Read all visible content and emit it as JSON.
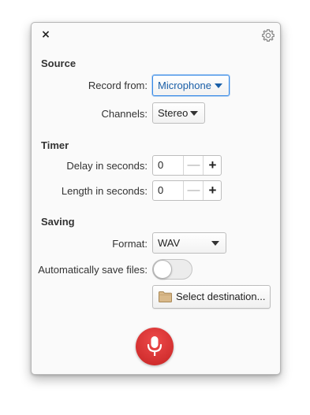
{
  "window": {
    "close_glyph": "×",
    "settings_icon": "gear-icon"
  },
  "source": {
    "title": "Source",
    "record_from_label": "Record from:",
    "record_from_value": "Microphone",
    "channels_label": "Channels:",
    "channels_value": "Stereo"
  },
  "timer": {
    "title": "Timer",
    "delay_label": "Delay in seconds:",
    "delay_value": "0",
    "length_label": "Length in seconds:",
    "length_value": "0",
    "minus_glyph": "—",
    "plus_glyph": "+"
  },
  "saving": {
    "title": "Saving",
    "format_label": "Format:",
    "format_value": "WAV",
    "autosave_label": "Automatically save files:",
    "autosave_on": false,
    "destination_button": "Select destination..."
  },
  "record": {
    "icon": "microphone-icon",
    "color": "#d93535"
  },
  "colors": {
    "focus_accent": "#3689e6",
    "record_red": "#d93535"
  }
}
